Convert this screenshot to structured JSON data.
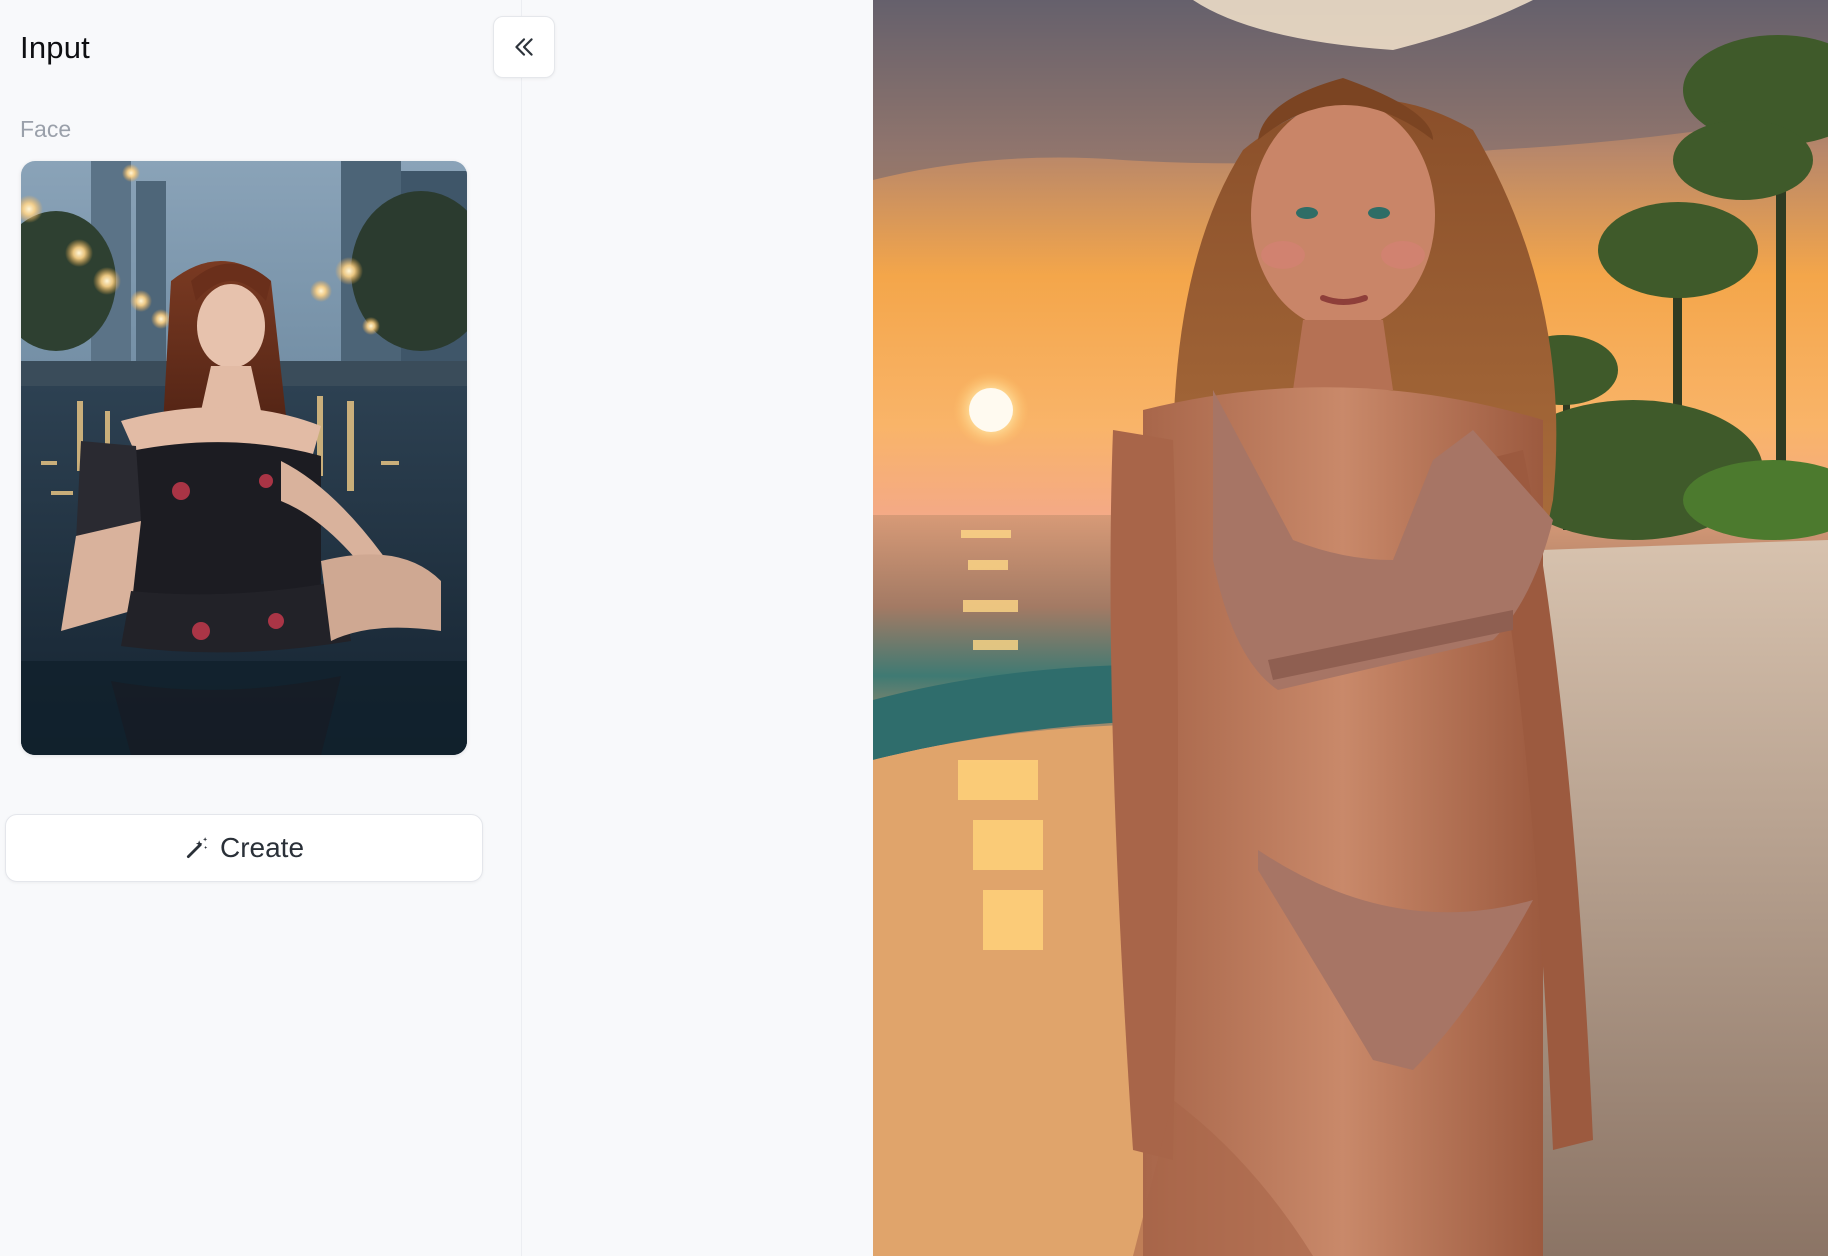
{
  "panel": {
    "title": "Input",
    "collapse_icon": "double-chevron-left-icon",
    "face_label": "Face",
    "create_label": "Create",
    "create_icon": "magic-wand-icon"
  },
  "face_image": {
    "alt": "Woman in a black dress sitting in water at night with city lights"
  },
  "output_image": {
    "alt": "Woman in a bikini standing on a beach at sunset with palm trees"
  },
  "colors": {
    "background": "#f8f9fb",
    "title_text": "#0e0f12",
    "muted_text": "#9aa0aa",
    "button_text": "#2a3038"
  }
}
